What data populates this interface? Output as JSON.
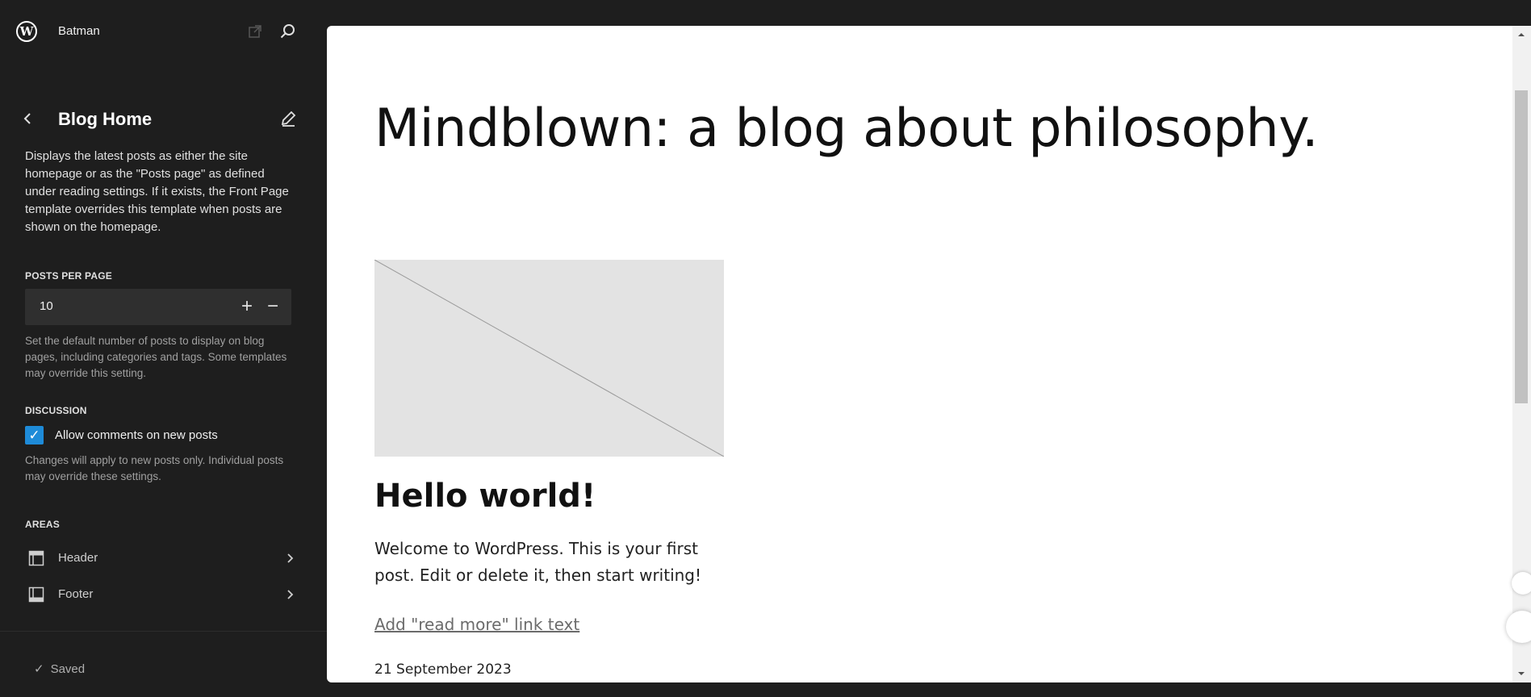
{
  "sidebar": {
    "site_title": "Batman",
    "nav_title": "Blog Home",
    "description": "Displays the latest posts as either the site homepage or as the \"Posts page\" as defined under reading settings. If it exists, the Front Page template overrides this template when posts are shown on the homepage.",
    "posts_per_page": {
      "label": "POSTS PER PAGE",
      "value": "10",
      "plus": "+",
      "minus": "−",
      "help": "Set the default number of posts to display on blog pages, including categories and tags. Some templates may override this setting."
    },
    "discussion": {
      "label": "DISCUSSION",
      "checkbox_label": "Allow comments on new posts",
      "checked": true,
      "help": "Changes will apply to new posts only. Individual posts may override these settings."
    },
    "areas": {
      "label": "AREAS",
      "items": [
        {
          "label": "Header",
          "icon": "header-layout-icon"
        },
        {
          "label": "Footer",
          "icon": "footer-layout-icon"
        }
      ]
    },
    "status": "Saved"
  },
  "canvas": {
    "site_heading": "Mindblown: a blog about philosophy.",
    "post": {
      "title": "Hello world!",
      "excerpt": "Welcome to WordPress. This is your first post. Edit or delete it, then start writing!",
      "read_more": "Add \"read more\" link text",
      "date": "21 September 2023"
    }
  },
  "colors": {
    "sidebar_bg": "#1e1e1e",
    "accent": "#1e8bd8",
    "canvas_bg": "#ffffff",
    "placeholder": "#e3e3e3"
  }
}
